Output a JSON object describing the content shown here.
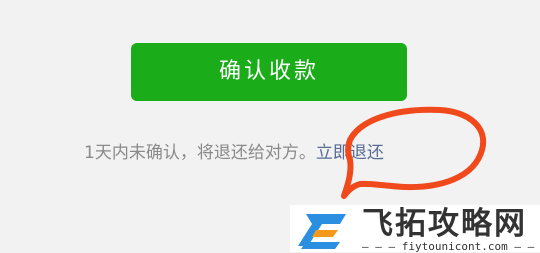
{
  "confirm_button": {
    "label": "确认收款"
  },
  "notice": {
    "text": "1天内未确认，将退还给对方。",
    "refund_link": "立即退还"
  },
  "watermark": {
    "site_name": "飞拓攻略网",
    "url": "— — — fiytounicont.com — — —"
  },
  "colors": {
    "button_green": "#1aad19",
    "link_blue": "#576b95",
    "annotation_red": "#f04a1c",
    "logo_blue": "#2a8fe0",
    "logo_orange": "#f39a1c"
  },
  "icons": {
    "watermark_logo": "stylized-e-logo-icon",
    "annotation": "red-circle-annotation"
  }
}
